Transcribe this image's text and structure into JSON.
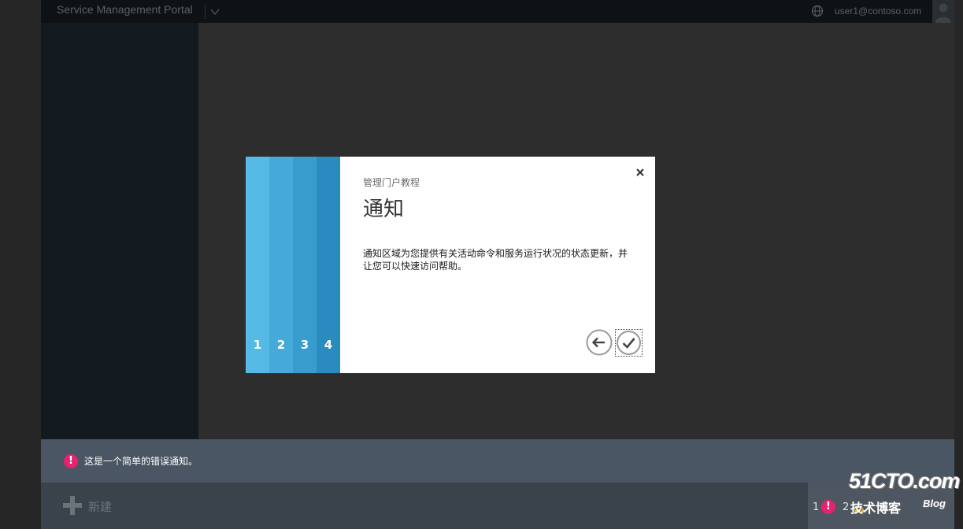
{
  "window": {
    "portal_title": "Service Management Portal",
    "user_email": "user1@contoso.com"
  },
  "dialog": {
    "subtitle": "管理门户教程",
    "title": "通知",
    "body": "通知区域为您提供有关活动命令和服务运行状况的状态更新，并让您可以快速访问帮助。",
    "steps": [
      {
        "label": "1",
        "color": "#55bbe6"
      },
      {
        "label": "2",
        "color": "#45aad9"
      },
      {
        "label": "3",
        "color": "#389ccd"
      },
      {
        "label": "4",
        "color": "#2a8cbe"
      }
    ]
  },
  "notification": {
    "text": "这是一个简单的错误通知。"
  },
  "command_bar": {
    "new_label": "新建",
    "error_count": "1",
    "warning_count": "2"
  },
  "watermark": {
    "main": "51CTO.com",
    "sub": "技术博客",
    "blog": "Blog"
  },
  "colors": {
    "accent_error": "#e4226f",
    "notification_bg": "#4a5663",
    "sidebar_bg": "#12191f"
  }
}
